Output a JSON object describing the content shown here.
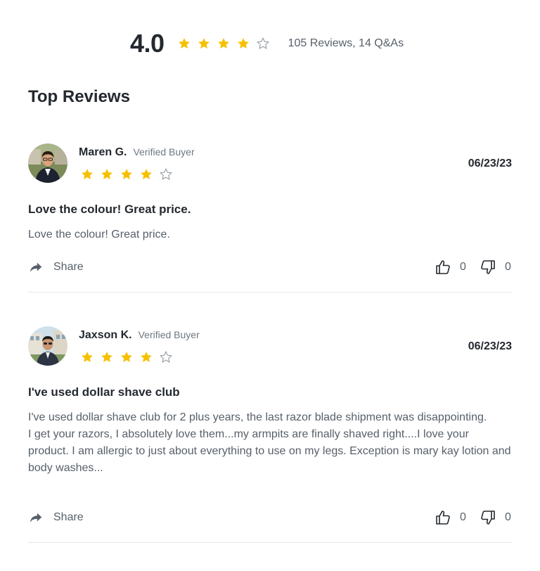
{
  "summary": {
    "average": "4.0",
    "rating": 4,
    "max_rating": 5,
    "count_text": "105 Reviews, 14 Q&As"
  },
  "section_title": "Top Reviews",
  "colors": {
    "star_filled": "#F6C000",
    "star_empty": "#9AA0A6",
    "text_primary": "#24292F",
    "text_secondary": "#57606A",
    "divider": "#E5E7EB"
  },
  "reviews": [
    {
      "name": "Maren G.",
      "badge": "Verified Buyer",
      "rating": 4,
      "date": "06/23/23",
      "title": "Love the colour! Great price.",
      "body": [
        "Love the colour! Great price."
      ],
      "share_label": "Share",
      "helpful_count": "0",
      "unhelpful_count": "0",
      "avatar_icon": "user-avatar-photo"
    },
    {
      "name": "Jaxson K.",
      "badge": "Verified Buyer",
      "rating": 4,
      "date": "06/23/23",
      "title": "I've used dollar shave club",
      "body": [
        "I've used dollar shave club for 2 plus years, the last razor blade shipment was disappointing.",
        "I get your razors, I absolutely love them...my armpits are finally shaved right....I love your product. I am allergic to just about everything to use on my legs. Exception is mary kay lotion and body washes..."
      ],
      "share_label": "Share",
      "helpful_count": "0",
      "unhelpful_count": "0",
      "avatar_icon": "user-avatar-photo"
    }
  ],
  "icons": {
    "star": "star-icon",
    "share": "share-arrow-icon",
    "thumbs_up": "thumbs-up-icon",
    "thumbs_down": "thumbs-down-icon"
  }
}
